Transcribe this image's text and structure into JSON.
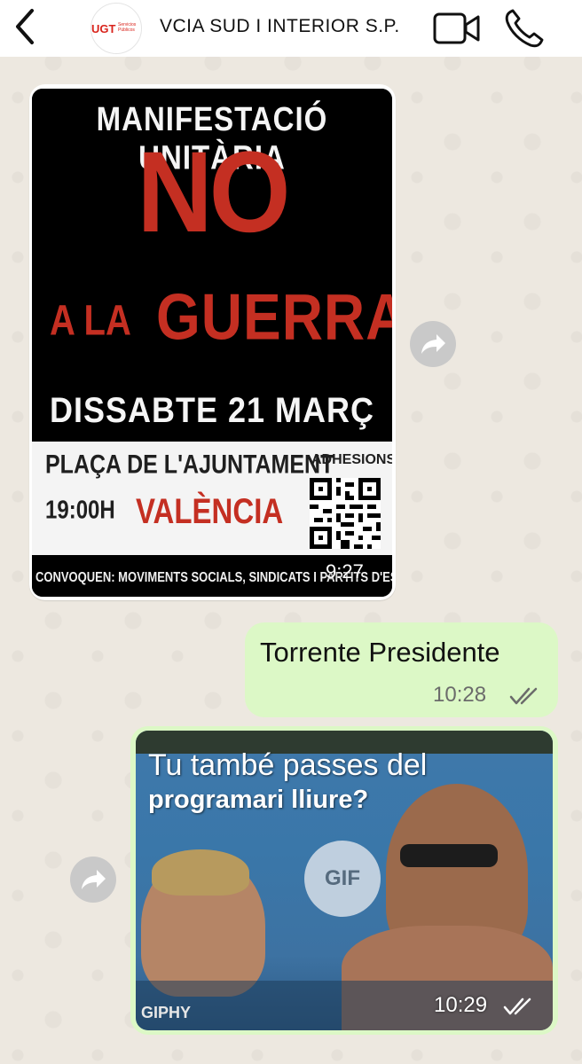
{
  "header": {
    "back_icon": "chevron-left-icon",
    "avatar": {
      "logo": "UGT",
      "sub_line1": "Servicios",
      "sub_line2": "Públicos"
    },
    "title": "VCIA SUD I INTERIOR S.P.",
    "video_icon": "video-camera-icon",
    "phone_icon": "phone-icon"
  },
  "messages": {
    "poster": {
      "line1": "MANIFESTACIÓ UNITÀRIA",
      "line2": "NO",
      "line3a": "A LA",
      "line3b": "GUERRA",
      "line4": "DISSABTE 21 MARÇ",
      "place": "PLAÇA DE L'AJUNTAMENT",
      "hour": "19:00H",
      "city": "VALÈNCIA",
      "adhesions": "ADHESIONS:",
      "convoquen": "CONVOQUEN: MOVIMENTS SOCIALS, SINDICATS I PARTITS D'ESQUERRA",
      "time": "9:27"
    },
    "outgoing_text": {
      "text": "Torrente Presidente",
      "time": "10:28",
      "status": "read-double-check"
    },
    "gif": {
      "caption_line1": "Tu també passes del",
      "caption_line2": "programari lliure?",
      "badge": "GIF",
      "source": "GIPHY",
      "time": "10:29",
      "status": "read-double-check"
    }
  },
  "colors": {
    "chat_background": "#ede8e0",
    "outgoing_bubble": "#dcf8c6",
    "poster_red": "#c42f22",
    "ugt_red": "#d9241c"
  }
}
